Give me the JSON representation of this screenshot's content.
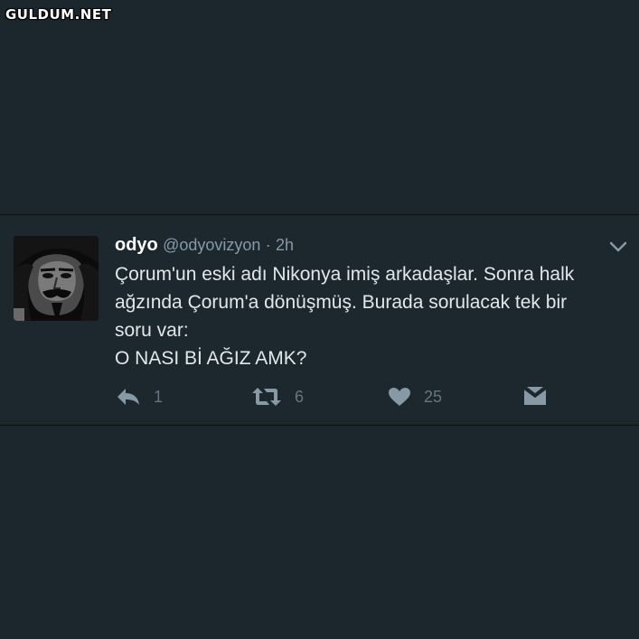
{
  "watermark": "GULDUM.NET",
  "tweet": {
    "name": "odyo",
    "handle": "@odyovizyon",
    "separator": "·",
    "time": "2h",
    "lines": [
      "Çorum'un eski adı Nikonya imiş arkadaşlar. Sonra halk",
      "ağzında Çorum'a dönüşmüş. Burada sorulacak tek bir",
      "soru var:",
      "O NASI Bİ AĞIZ AMK?"
    ],
    "actions": {
      "reply_count": "1",
      "retweet_count": "6",
      "like_count": "25"
    }
  },
  "colors": {
    "background": "#1b262d",
    "text": "#e1e8ed",
    "muted": "#8899a6",
    "icon": "#8899a6"
  },
  "icons": {
    "reply": "reply-icon",
    "retweet": "retweet-icon",
    "like": "heart-icon",
    "dm": "direct-message-icon",
    "menu": "chevron-down-icon"
  }
}
